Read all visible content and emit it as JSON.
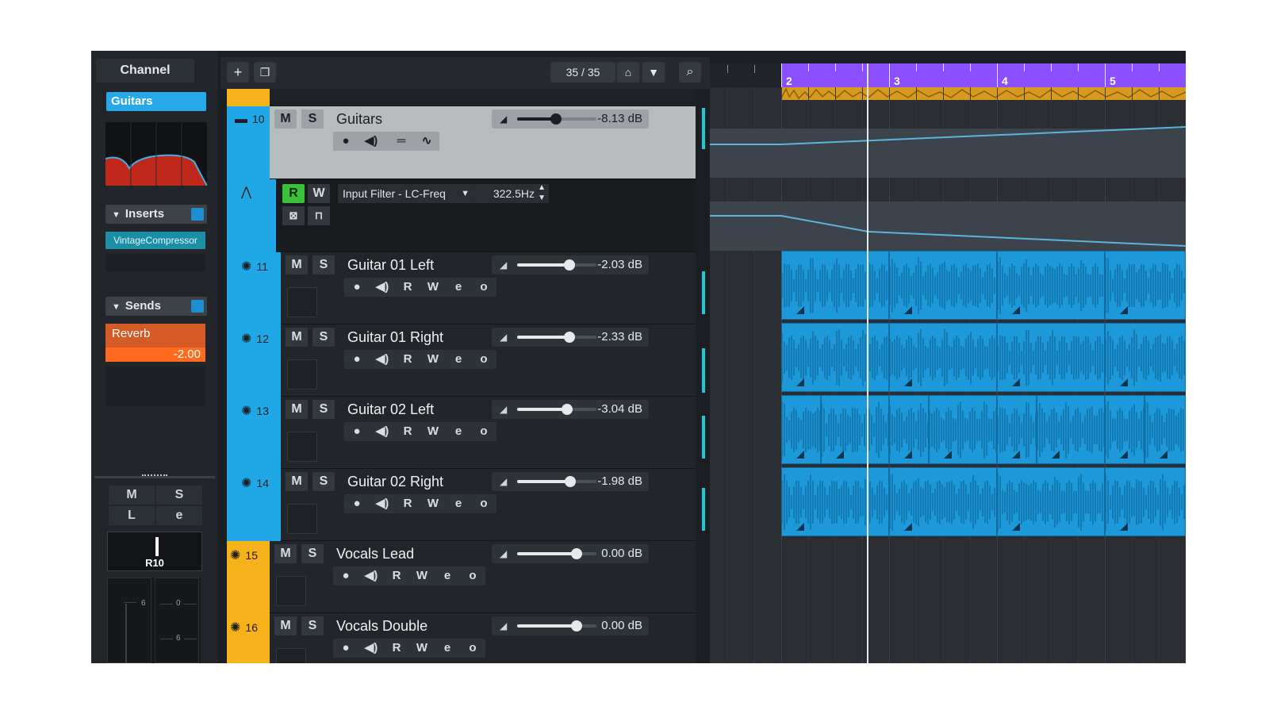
{
  "channel": {
    "tab_label": "Channel",
    "name": "Guitars",
    "inserts_label": "Inserts",
    "insert_slot": "VintageCompressor",
    "sends_label": "Sends",
    "send_name": "Reverb",
    "send_value": "-2.00",
    "mute": "M",
    "solo": "S",
    "listen": "L",
    "edit": "e",
    "pan_label": "R10",
    "meter_marks": [
      "6",
      "0",
      "6"
    ]
  },
  "toolbar": {
    "add_icon": "plus-icon",
    "track_count": "35 / 35"
  },
  "tracks": [
    {
      "num": "10",
      "name": "Guitars",
      "volume": "-8.13 dB",
      "level": 0.49,
      "color": "#20a8e6",
      "folder": true
    },
    {
      "num": "11",
      "name": "Guitar 01 Left",
      "volume": "-2.03 dB",
      "level": 0.66,
      "color": "#20a8e6"
    },
    {
      "num": "12",
      "name": "Guitar 01 Right",
      "volume": "-2.33 dB",
      "level": 0.66,
      "color": "#20a8e6"
    },
    {
      "num": "13",
      "name": "Guitar 02 Left",
      "volume": "-3.04 dB",
      "level": 0.63,
      "color": "#20a8e6"
    },
    {
      "num": "14",
      "name": "Guitar 02 Right",
      "volume": "-1.98 dB",
      "level": 0.67,
      "color": "#20a8e6"
    },
    {
      "num": "15",
      "name": "Vocals Lead",
      "volume": "0.00 dB",
      "level": 0.75,
      "color": "#f5b21b"
    },
    {
      "num": "16",
      "name": "Vocals Double",
      "volume": "0.00 dB",
      "level": 0.75,
      "color": "#f5b21b"
    }
  ],
  "automation": {
    "read": "R",
    "write": "W",
    "parameter": "Input Filter - LC-Freq",
    "value": "322.5Hz"
  },
  "buttons": {
    "mute": "M",
    "solo": "S",
    "read": "R",
    "write": "W",
    "edit": "e",
    "power": "o"
  },
  "ruler": {
    "bars": [
      "2",
      "3",
      "4",
      "5"
    ]
  },
  "colors": {
    "accent": "#27a9e8",
    "clip": "#1d98d8",
    "marker": "#8a4fff",
    "vocals": "#f5b21b",
    "send": "#ff6b1e"
  }
}
